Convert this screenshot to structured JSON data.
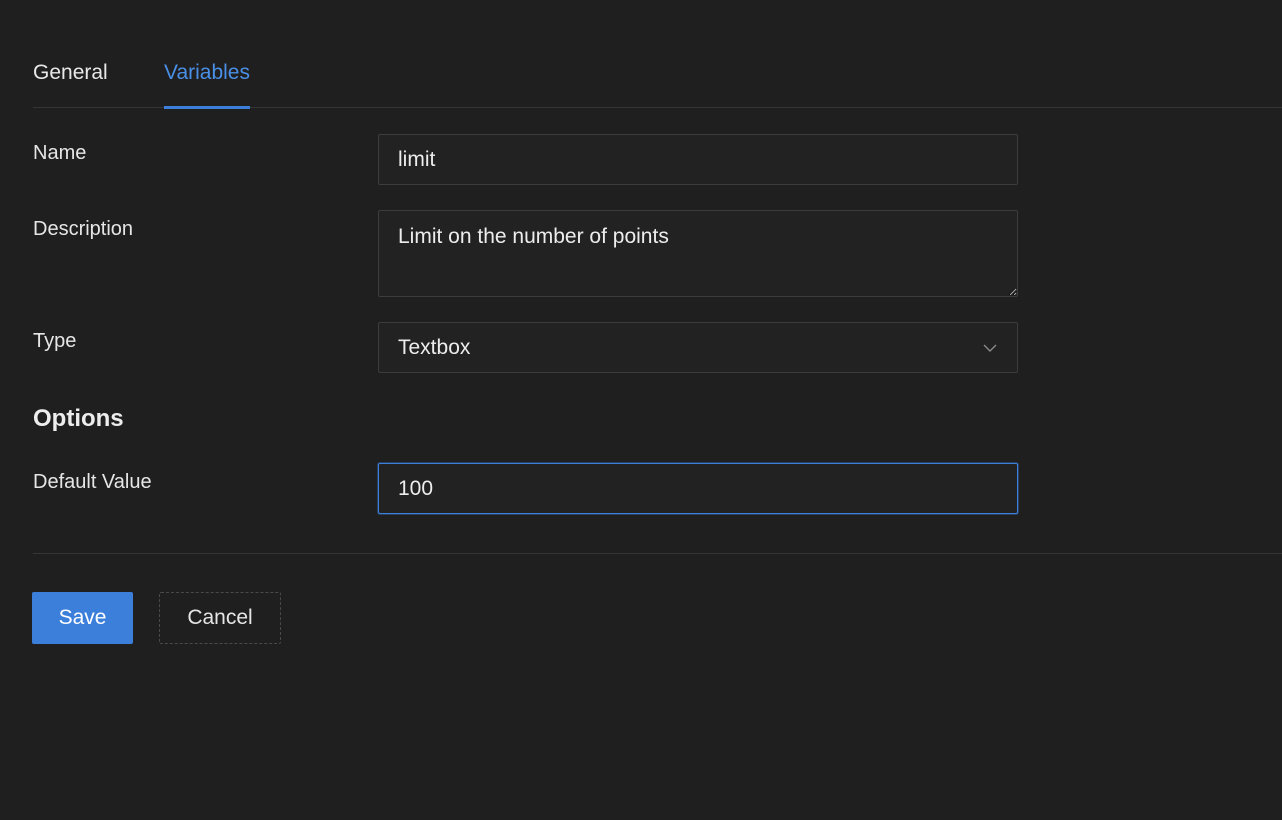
{
  "tabs": [
    {
      "label": "General",
      "active": false
    },
    {
      "label": "Variables",
      "active": true
    }
  ],
  "form": {
    "name": {
      "label": "Name",
      "value": "limit"
    },
    "description": {
      "label": "Description",
      "value": "Limit on the number of points"
    },
    "type": {
      "label": "Type",
      "value": "Textbox"
    },
    "options_heading": "Options",
    "default_value": {
      "label": "Default Value",
      "value": "100"
    }
  },
  "actions": {
    "save_label": "Save",
    "cancel_label": "Cancel"
  },
  "colors": {
    "background": "#1f1f1f",
    "accent": "#3b7fdb",
    "active_tab_text": "#4a8fe6"
  },
  "icons": {
    "type_dropdown": "chevron-down-icon"
  }
}
